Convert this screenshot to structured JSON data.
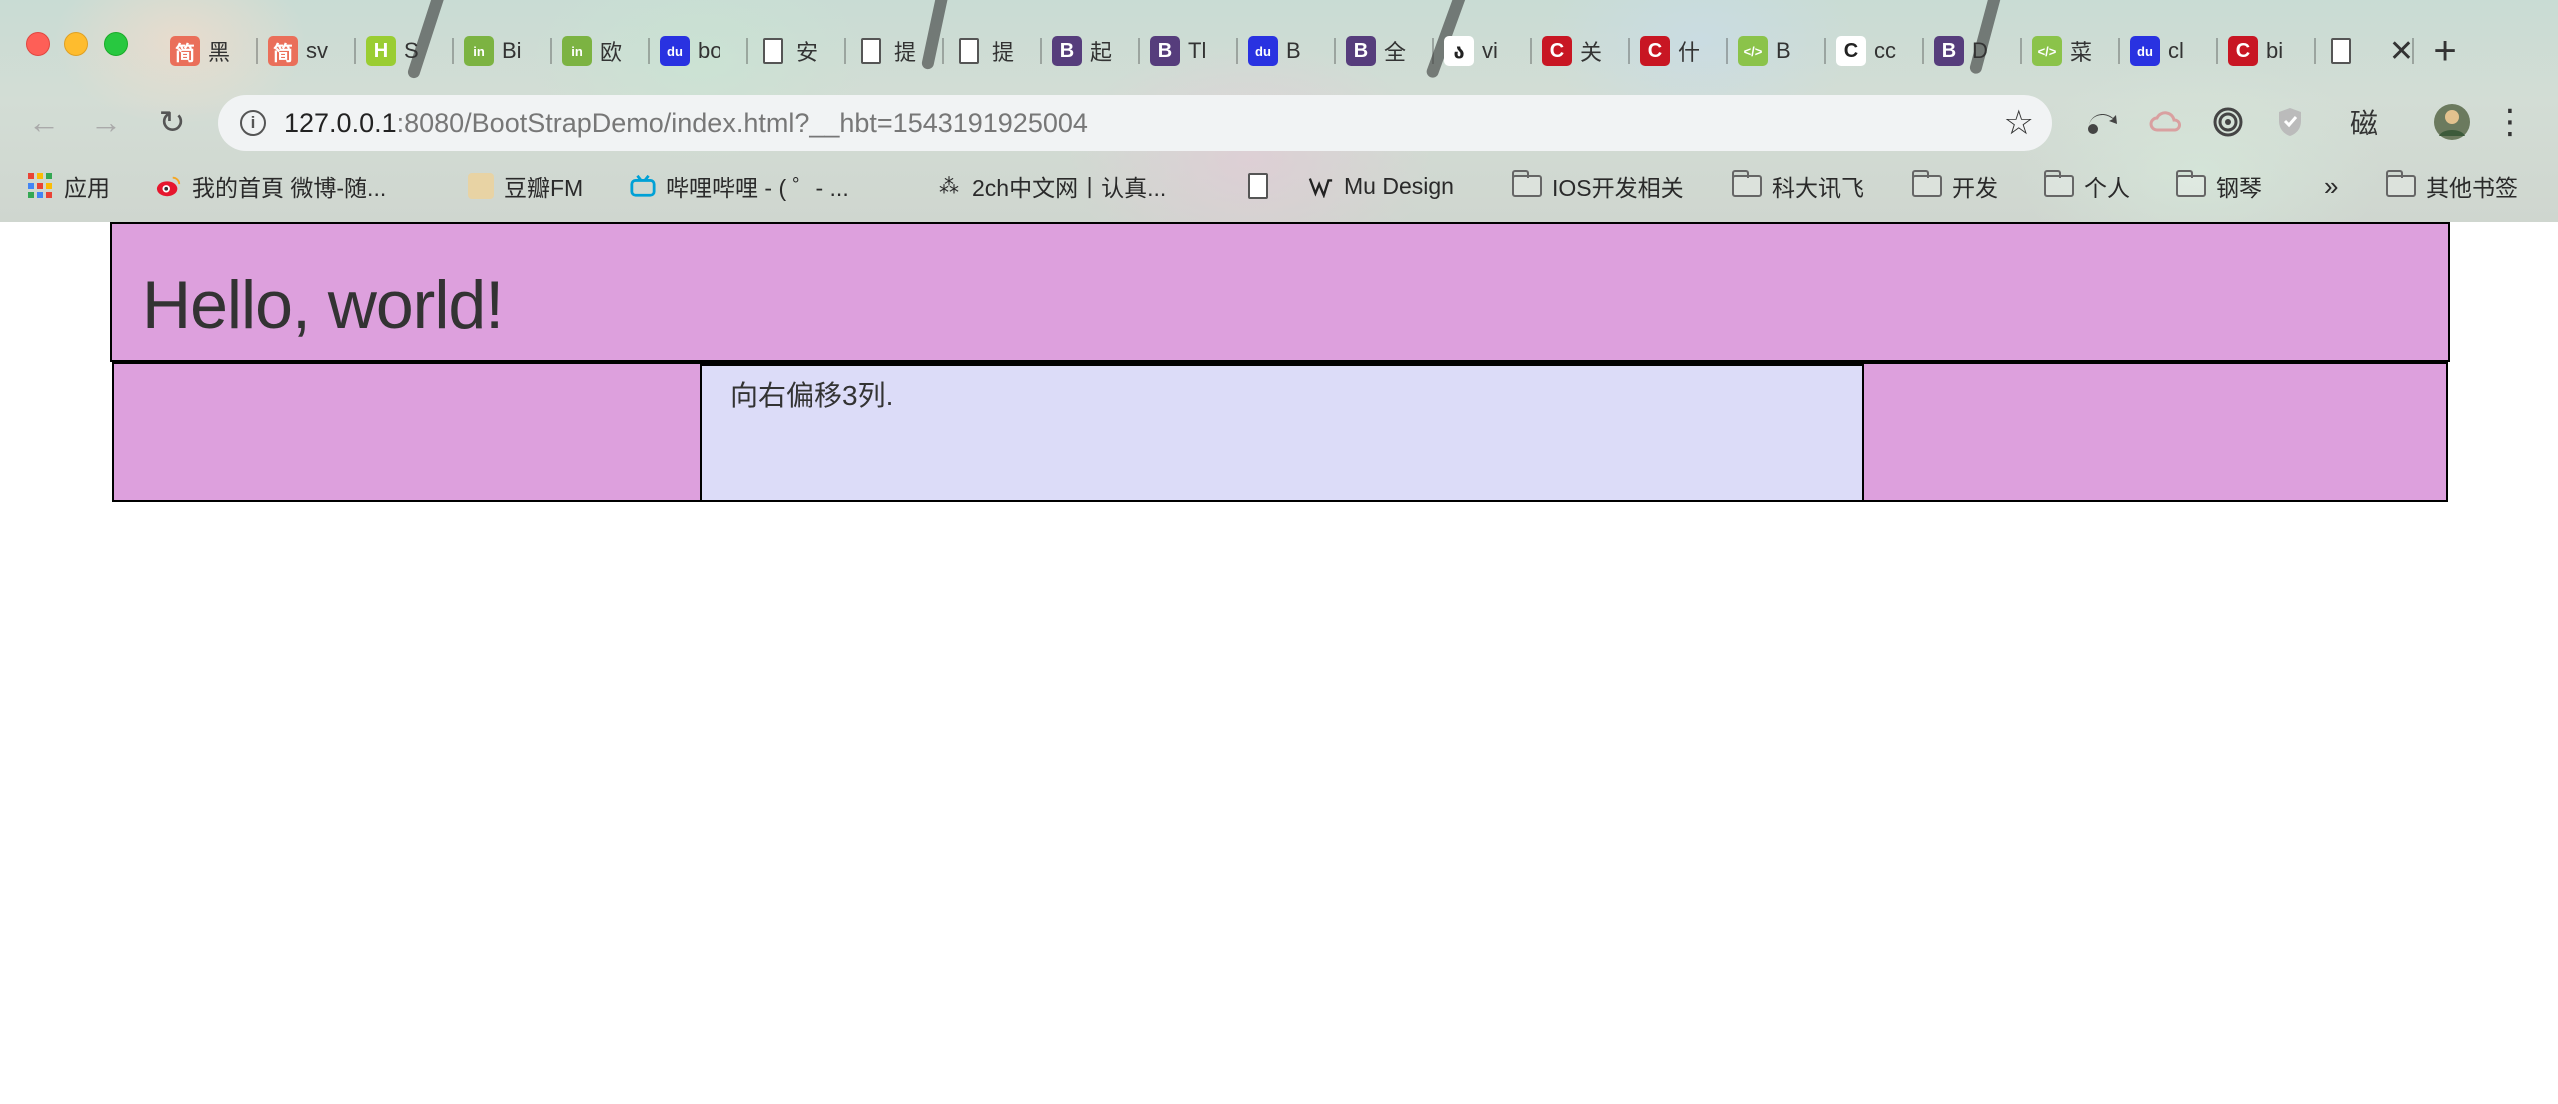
{
  "window": {
    "controls": [
      "close",
      "minimize",
      "maximize"
    ]
  },
  "tabs": [
    {
      "icon": "jianshu-icon",
      "icon_text": "简",
      "color": "#ea6f5a",
      "title": "黑"
    },
    {
      "icon": "jianshu-icon",
      "icon_text": "简",
      "color": "#ea6f5a",
      "title": "sv"
    },
    {
      "icon": "h-icon",
      "icon_text": "H",
      "color": "#9acd32",
      "title": "S"
    },
    {
      "icon": "in-icon",
      "icon_text": "in",
      "color": "#7cb342",
      "title": "Bi"
    },
    {
      "icon": "in-icon",
      "icon_text": "in",
      "color": "#7cb342",
      "title": "欧"
    },
    {
      "icon": "baidu-icon",
      "icon_text": "du",
      "color": "#2932e1",
      "title": "bo"
    },
    {
      "icon": "page-icon",
      "icon_text": "",
      "color": "#ffffff",
      "title": "安"
    },
    {
      "icon": "page-icon",
      "icon_text": "",
      "color": "#ffffff",
      "title": "提"
    },
    {
      "icon": "page-icon",
      "icon_text": "",
      "color": "#ffffff",
      "title": "提"
    },
    {
      "icon": "bootstrap-icon",
      "icon_text": "B",
      "color": "#563d7c",
      "title": "起"
    },
    {
      "icon": "bootstrap-icon",
      "icon_text": "B",
      "color": "#563d7c",
      "title": "Tl"
    },
    {
      "icon": "baidu-icon",
      "icon_text": "du",
      "color": "#2932e1",
      "title": "B"
    },
    {
      "icon": "bootstrap-icon",
      "icon_text": "B",
      "color": "#563d7c",
      "title": "全"
    },
    {
      "icon": "vue-script-icon",
      "icon_text": "ა",
      "color": "#ffffff",
      "title": "vi"
    },
    {
      "icon": "csdn-icon",
      "icon_text": "C",
      "color": "#c81623",
      "title": "关"
    },
    {
      "icon": "csdn-icon",
      "icon_text": "C",
      "color": "#c81623",
      "title": "什"
    },
    {
      "icon": "code-icon",
      "icon_text": "</>",
      "color": "#8bc34a",
      "title": "B"
    },
    {
      "icon": "c-icon",
      "icon_text": "C",
      "color": "#ffffff",
      "title": "cc"
    },
    {
      "icon": "bootstrap-icon",
      "icon_text": "B",
      "color": "#563d7c",
      "title": "D"
    },
    {
      "icon": "code-icon",
      "icon_text": "</>",
      "color": "#8bc34a",
      "title": "菜"
    },
    {
      "icon": "baidu-icon",
      "icon_text": "du",
      "color": "#2932e1",
      "title": "cl"
    },
    {
      "icon": "csdn-icon",
      "icon_text": "C",
      "color": "#c81623",
      "title": "bi"
    },
    {
      "icon": "page-icon",
      "icon_text": "",
      "color": "#ffffff",
      "title": ""
    }
  ],
  "toolbar": {
    "back": "←",
    "forward": "→",
    "reload": "↻",
    "new_tab": "+",
    "tab_close": "✕",
    "url_host": "127.0.0.1",
    "url_rest": ":8080/BootStrapDemo/index.html?__hbt=1543191925004",
    "info": "i",
    "bookmark_star": "☆",
    "extension_text": "磁",
    "menu": "⋮"
  },
  "bookmarks": [
    {
      "label": "应用",
      "icon": "apps-icon"
    },
    {
      "label": "我的首頁 微博-随...",
      "icon": "weibo-icon"
    },
    {
      "label": "豆瓣FM",
      "icon": "douban-fm-icon"
    },
    {
      "label": "哔哩哔哩 - ( ゜- ...",
      "icon": "bilibili-icon"
    },
    {
      "label": "2ch中文网丨认真...",
      "icon": "2ch-icon"
    },
    {
      "label": "",
      "icon": "page-icon"
    },
    {
      "label": "Mu Design",
      "icon": "mu-design-icon"
    },
    {
      "label": "IOS开发相关",
      "icon": "folder-icon"
    },
    {
      "label": "科大讯飞",
      "icon": "folder-icon"
    },
    {
      "label": "开发",
      "icon": "folder-icon"
    },
    {
      "label": "个人",
      "icon": "folder-icon"
    },
    {
      "label": "钢琴",
      "icon": "folder-icon"
    },
    {
      "label": "»",
      "icon": ""
    },
    {
      "label": "其他书签",
      "icon": "folder-icon"
    }
  ],
  "page": {
    "heading": "Hello, world!",
    "offset_text": "向右偏移3列.",
    "colors": {
      "jumbotron_bg": "#dda0dd",
      "column_bg": "#dcdcf8",
      "border": "#000000"
    }
  }
}
